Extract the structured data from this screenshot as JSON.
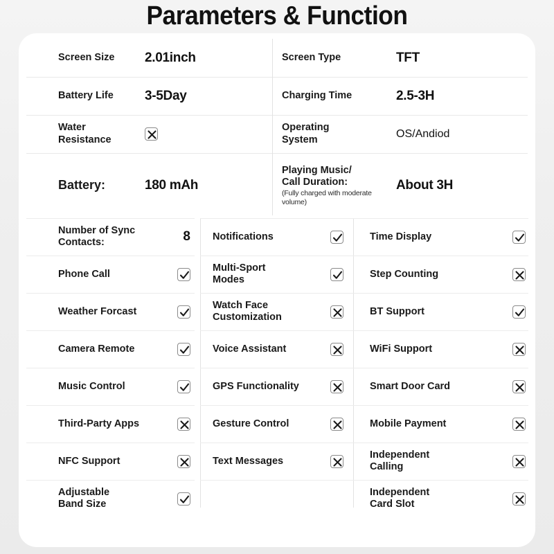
{
  "header": {
    "title": "Parameters & Function"
  },
  "icons": {
    "checked": "checkbox-checked-icon",
    "unchecked": "checkbox-crossed-icon"
  },
  "colors": {
    "page_background": "#f0f0f0",
    "card_background": "#ffffff",
    "text": "#1a1a1a",
    "divider": "#e6e6e6",
    "box_border": "#8a8a8a"
  },
  "spec_table": {
    "rows": [
      {
        "left": {
          "label": "Screen Size",
          "value": "2.01inch",
          "style": "bold"
        },
        "right": {
          "label": "Screen Type",
          "value": "TFT",
          "style": "bold"
        }
      },
      {
        "left": {
          "label": "Battery Life",
          "value": "3-5Day",
          "style": "bold"
        },
        "right": {
          "label": "Charging Time",
          "value": "2.5-3H",
          "style": "bold"
        }
      },
      {
        "left": {
          "label": "Water\nResistance",
          "value": "",
          "mark": "unchecked"
        },
        "right": {
          "label": "Operating\nSystem",
          "value": "OS/Andiod",
          "style": "thin"
        }
      },
      {
        "left": {
          "label": "Battery:",
          "value": "180 mAh",
          "style": "bold",
          "label_big": true
        },
        "right": {
          "label": "Playing Music/\nCall Duration:",
          "note": "(Fully charged with moderate volume)",
          "value": "About 3H",
          "style": "bold"
        }
      }
    ]
  },
  "feature_grid": {
    "columns": [
      {
        "items": [
          {
            "label": "Number of Sync\nContacts:",
            "value": "8",
            "type": "number"
          },
          {
            "label": "Phone Call",
            "mark": "checked"
          },
          {
            "label": "Weather Forcast",
            "mark": "checked"
          },
          {
            "label": "Camera Remote",
            "mark": "checked"
          },
          {
            "label": "Music Control",
            "mark": "checked"
          },
          {
            "label": "Third-Party Apps",
            "mark": "unchecked"
          },
          {
            "label": "NFC Support",
            "mark": "unchecked"
          },
          {
            "label": "Adjustable\nBand Size",
            "mark": "checked"
          }
        ]
      },
      {
        "items": [
          {
            "label": "Notifications",
            "mark": "checked"
          },
          {
            "label": "Multi-Sport\nModes",
            "mark": "checked"
          },
          {
            "label": "Watch Face\nCustomization",
            "mark": "unchecked"
          },
          {
            "label": "Voice Assistant",
            "mark": "unchecked"
          },
          {
            "label": "GPS Functionality",
            "mark": "unchecked"
          },
          {
            "label": "Gesture Control",
            "mark": "unchecked"
          },
          {
            "label": "Text Messages",
            "mark": "unchecked"
          },
          {
            "label": "",
            "mark": "none"
          }
        ]
      },
      {
        "items": [
          {
            "label": "Time Display",
            "mark": "checked"
          },
          {
            "label": "Step Counting",
            "mark": "unchecked"
          },
          {
            "label": "BT Support",
            "mark": "checked"
          },
          {
            "label": "WiFi Support",
            "mark": "unchecked"
          },
          {
            "label": "Smart Door Card",
            "mark": "unchecked"
          },
          {
            "label": "Mobile Payment",
            "mark": "unchecked"
          },
          {
            "label": "Independent\nCalling",
            "mark": "unchecked"
          },
          {
            "label": "Independent\nCard Slot",
            "mark": "unchecked"
          }
        ]
      }
    ]
  }
}
